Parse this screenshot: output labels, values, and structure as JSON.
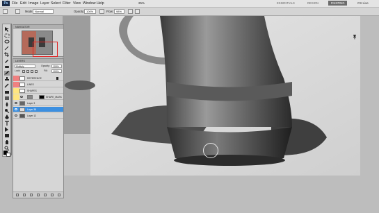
{
  "menubar": {
    "logo": "Ps",
    "items": [
      "File",
      "Edit",
      "Image",
      "Layer",
      "Select",
      "Filter",
      "View",
      "Window",
      "Help"
    ],
    "zoom": "25%",
    "workspaces": [
      "ESSENTIALS",
      "DESIGN",
      "PAINTING"
    ],
    "cs_live": "CS Live"
  },
  "options": {
    "mode_label": "Mode:",
    "mode_value": "Normal",
    "opacity_label": "Opacity:",
    "opacity_value": "100%",
    "flow_label": "Flow:",
    "flow_value": "98%"
  },
  "navigator": {
    "title": "NAVIGATOR"
  },
  "layers": {
    "title": "LAYERS",
    "blend_mode": "Multiply",
    "opacity_label": "Opacity:",
    "opacity_value": "100%",
    "lock_label": "Lock:",
    "fill_label": "Fill:",
    "fill_value": "100%",
    "items": [
      {
        "name": "REFERENCE",
        "color": "#f08080"
      },
      {
        "name": "LINES",
        "color": "#f08080"
      },
      {
        "name": "SHAPES",
        "color": "#ffe680"
      },
      {
        "name": "SHAPE_MASK",
        "color": "#ffe680"
      },
      {
        "name": "Layer 3",
        "color": ""
      },
      {
        "name": "Layer 38",
        "color": ""
      },
      {
        "name": "Layer 12",
        "color": ""
      }
    ]
  },
  "colors": {
    "accent": "#3c8fe0",
    "canvas_bg": "#bdbdbd"
  }
}
